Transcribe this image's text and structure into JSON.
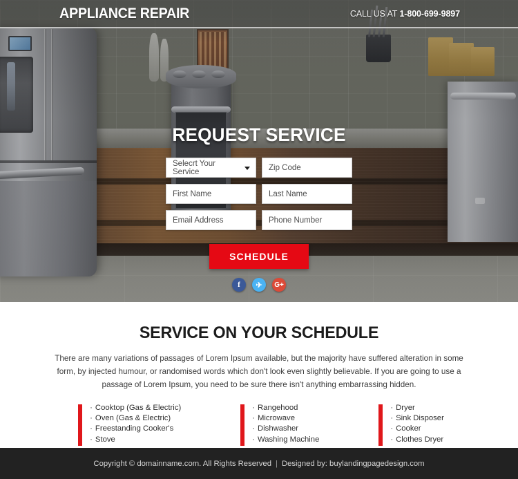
{
  "header": {
    "brand": "APPLIANCE REPAIR",
    "call_prefix": "CALL US AT ",
    "phone": "1-800-699-9897"
  },
  "hero": {
    "form_title": "REQUEST SERVICE",
    "fields": {
      "service_select": "Selecrt Your Service",
      "zip": "Zip Code",
      "first_name": "First Name",
      "last_name": "Last Name",
      "email": "Email Address",
      "phone": "Phone Number"
    },
    "submit_label": "SCHEDULE",
    "socials": [
      {
        "name": "facebook",
        "glyph": "f"
      },
      {
        "name": "twitter",
        "glyph": "✈"
      },
      {
        "name": "googleplus",
        "glyph": "G+"
      }
    ]
  },
  "mid": {
    "title": "SERVICE ON YOUR SCHEDULE",
    "paragraph": "There are many variations of passages of Lorem Ipsum available, but the majority have suffered alteration in some form, by injected humour, or randomised words which don't look even slightly believable. If you are going to use a passage of Lorem Ipsum, you need to be sure there isn't anything embarrassing hidden.",
    "columns": [
      {
        "items": [
          "Cooktop (Gas & Electric)",
          "Oven (Gas & Electric)",
          "Freestanding Cooker's",
          "Stove"
        ]
      },
      {
        "items": [
          "Rangehood",
          "Microwave",
          "Dishwasher",
          "Washing Machine"
        ]
      },
      {
        "items": [
          "Dryer",
          "Sink Disposer",
          "Cooker",
          "Clothes Dryer"
        ]
      }
    ]
  },
  "footer": {
    "copyright": "Copyright © domainname.com. All Rights Reserved",
    "separator": "|",
    "credit": "Designed by: buylandingpagedesign.com"
  },
  "colors": {
    "accent_red": "#e50914",
    "bar_red": "#e0171b",
    "footer_bg": "#222222",
    "facebook": "#3b5998",
    "twitter": "#4ab3f4",
    "googleplus": "#dc4a38"
  }
}
